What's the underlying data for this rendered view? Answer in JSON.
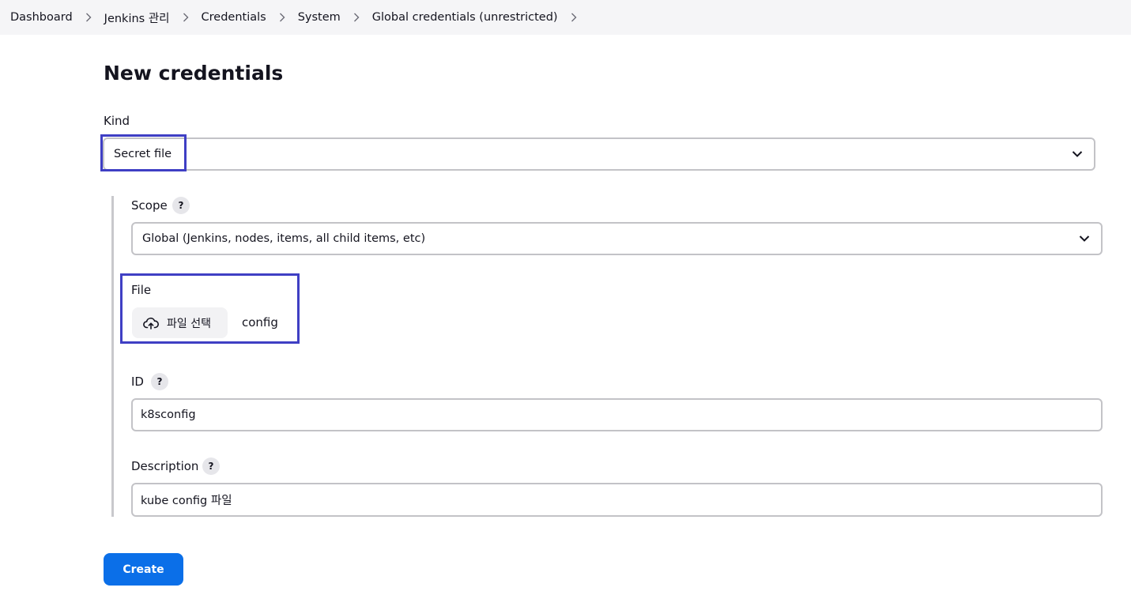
{
  "breadcrumb": {
    "items": [
      "Dashboard",
      "Jenkins 관리",
      "Credentials",
      "System",
      "Global credentials (unrestricted)"
    ],
    "separator_icon": "chevron-right-icon"
  },
  "page": {
    "title": "New credentials"
  },
  "form": {
    "kind": {
      "label": "Kind",
      "value": "Secret file"
    },
    "scope": {
      "label": "Scope",
      "help": "?",
      "value": "Global (Jenkins, nodes, items, all child items, etc)"
    },
    "file": {
      "label": "File",
      "button_label": "파일 선택",
      "button_icon": "cloud-upload-icon",
      "selected_file": "config"
    },
    "id": {
      "label": "ID",
      "help": "?",
      "value": "k8sconfig"
    },
    "description": {
      "label": "Description",
      "help": "?",
      "value": "kube config 파일"
    }
  },
  "actions": {
    "create_label": "Create"
  },
  "colors": {
    "accent": "#0b6fe8",
    "highlight": "#3f3fc4",
    "breadcrumb_bg": "#f5f5f7"
  }
}
